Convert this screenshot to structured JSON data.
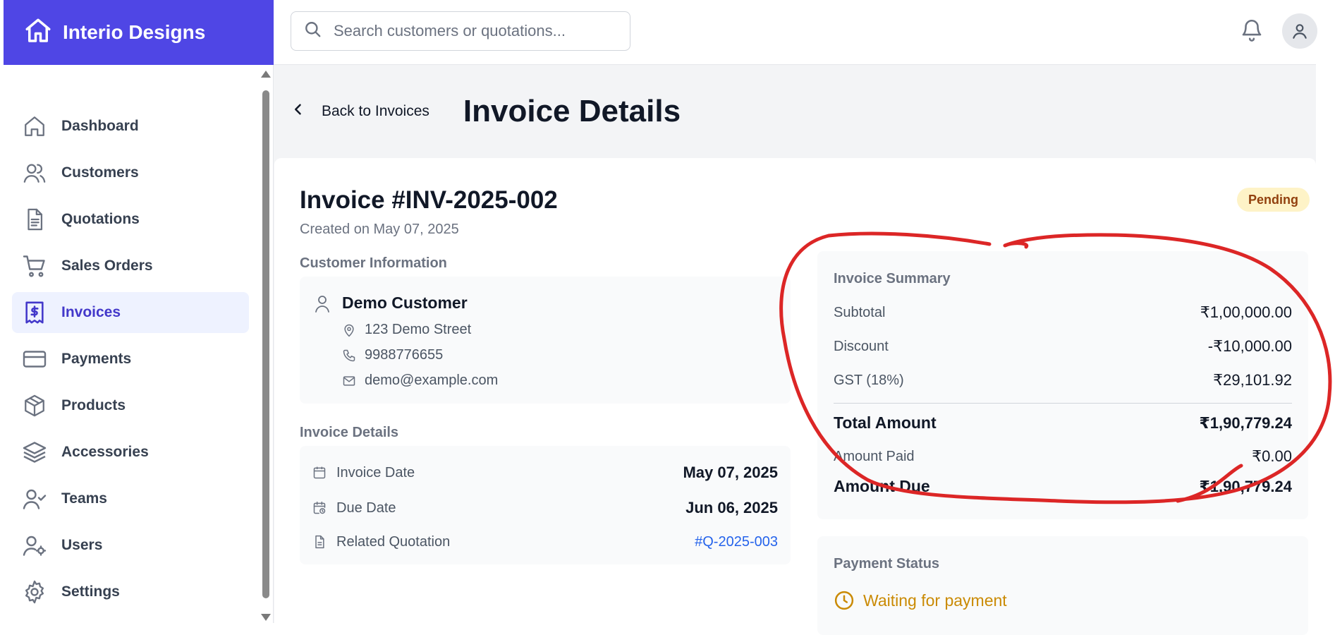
{
  "brand": {
    "name": "Interio Designs"
  },
  "header": {
    "search_placeholder": "Search customers or quotations..."
  },
  "sidebar": {
    "items": [
      {
        "label": "Dashboard",
        "icon": "home-icon",
        "active": false
      },
      {
        "label": "Customers",
        "icon": "users-icon",
        "active": false
      },
      {
        "label": "Quotations",
        "icon": "document-icon",
        "active": false
      },
      {
        "label": "Sales Orders",
        "icon": "cart-icon",
        "active": false
      },
      {
        "label": "Invoices",
        "icon": "receipt-dollar-icon",
        "active": true
      },
      {
        "label": "Payments",
        "icon": "credit-card-icon",
        "active": false
      },
      {
        "label": "Products",
        "icon": "box-icon",
        "active": false
      },
      {
        "label": "Accessories",
        "icon": "layers-icon",
        "active": false
      },
      {
        "label": "Teams",
        "icon": "user-check-icon",
        "active": false
      },
      {
        "label": "Users",
        "icon": "user-gear-icon",
        "active": false
      },
      {
        "label": "Settings",
        "icon": "gear-icon",
        "active": false
      }
    ]
  },
  "page": {
    "back_label": "Back to Invoices",
    "title": "Invoice Details"
  },
  "invoice": {
    "title": "Invoice #INV-2025-002",
    "created": "Created on May 07, 2025",
    "status": "Pending",
    "customer_section_label": "Customer Information",
    "customer": {
      "name": "Demo Customer",
      "address": "123 Demo Street",
      "phone": "9988776655",
      "email": "demo@example.com"
    },
    "details_section_label": "Invoice Details",
    "details": {
      "invoice_date_label": "Invoice Date",
      "invoice_date": "May 07, 2025",
      "due_date_label": "Due Date",
      "due_date": "Jun 06, 2025",
      "related_quotation_label": "Related Quotation",
      "related_quotation": "#Q-2025-003"
    },
    "summary": {
      "title": "Invoice Summary",
      "subtotal_label": "Subtotal",
      "subtotal": "₹1,00,000.00",
      "discount_label": "Discount",
      "discount": "-₹10,000.00",
      "gst_label": "GST (18%)",
      "gst": "₹29,101.92",
      "total_label": "Total Amount",
      "total": "₹1,90,779.24",
      "paid_label": "Amount Paid",
      "paid": "₹0.00",
      "due_label": "Amount Due",
      "due": "₹1,90,779.24"
    },
    "payment_status": {
      "title": "Payment Status",
      "text": "Waiting for payment"
    }
  },
  "colors": {
    "brand": "#4f46e5",
    "active_bg": "#eef2ff",
    "pending_bg": "#fef3c7",
    "waiting": "#ca8a04",
    "link": "#2563eb",
    "annotation": "#dc2626"
  }
}
